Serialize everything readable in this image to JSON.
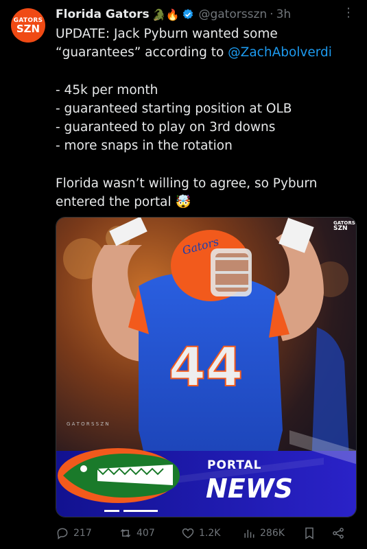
{
  "avatar": {
    "line1": "GATORS",
    "line2": "SZN"
  },
  "post": {
    "display_name": "Florida Gators",
    "name_emojis": "🐊🔥",
    "handle": "@gatorsszn",
    "separator": "·",
    "time": "3h",
    "text_line1": "UPDATE: Jack Pyburn wanted some",
    "text_line2_a": "“guarantees” according to ",
    "mention": "@ZachAbolverdi",
    "list": [
      "- 45k per month",
      "- guaranteed starting position at OLB",
      "- guaranteed to play on 3rd downs",
      "- more snaps in the rotation"
    ],
    "closing_line1": "Florida wasn’t willing to agree, so Pyburn",
    "closing_line2": "entered the portal",
    "closing_emoji": "🤯"
  },
  "media": {
    "jersey_number": "44",
    "helmet_text": "Gators",
    "watermark": "G A T O R S S Z N",
    "corner_logo_line1": "GATORS",
    "corner_logo_line2": "SZN",
    "banner_line1": "PORTAL",
    "banner_line2": "NEWS",
    "colors": {
      "blue": "#1f4fd1",
      "orange": "#f25a1c",
      "banner": "#1a1aa8"
    }
  },
  "actions": {
    "replies": "217",
    "reposts": "407",
    "likes": "1.2K",
    "views": "286K"
  }
}
